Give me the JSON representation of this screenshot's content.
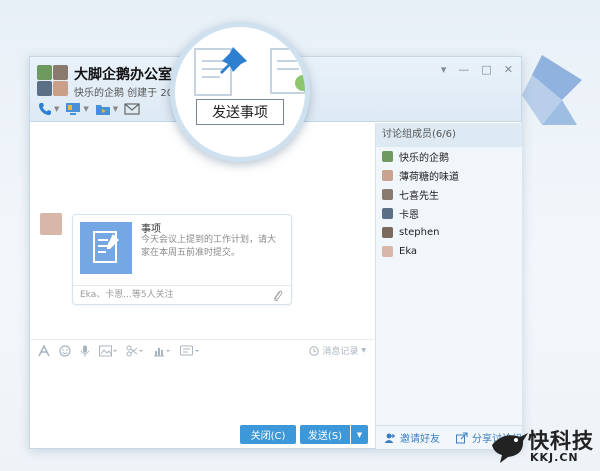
{
  "window": {
    "title": "大脚企鹅办公室",
    "subtitle": "快乐的企鹅  创建于 201",
    "controls": [
      "▾",
      "—",
      "□",
      "✕"
    ]
  },
  "magnifier": {
    "tooltip": "发送事项"
  },
  "chat": {
    "card": {
      "title": "事项",
      "text": "今天会议上提到的工作计划，请大家在本周五前准时提交。",
      "footer": "Eka、卡恩...等5人关注"
    },
    "history_label": "消息记录"
  },
  "buttons": {
    "close": "关闭(C)",
    "send": "发送(S)",
    "send_arrow": "▼"
  },
  "members": {
    "header": "讨论组成员(6/6)",
    "list": [
      {
        "name": "快乐的企鹅",
        "color": "#6d9a5e"
      },
      {
        "name": "薄荷糖的味道",
        "color": "#c9a38f"
      },
      {
        "name": "七喜先生",
        "color": "#8a7a6d"
      },
      {
        "name": "卡恩",
        "color": "#5b6f86"
      },
      {
        "name": "stephen",
        "color": "#7d6a5e"
      },
      {
        "name": "Eka",
        "color": "#d7b8a8"
      }
    ],
    "invite": "邀请好友",
    "share": "分享讨论组"
  },
  "watermark": {
    "main": "快科技",
    "sub": "KKJ.CN"
  },
  "colors": {
    "accent": "#3d98da",
    "card_icon_bg": "#74a7e3",
    "pin": "#2f7fd0"
  }
}
